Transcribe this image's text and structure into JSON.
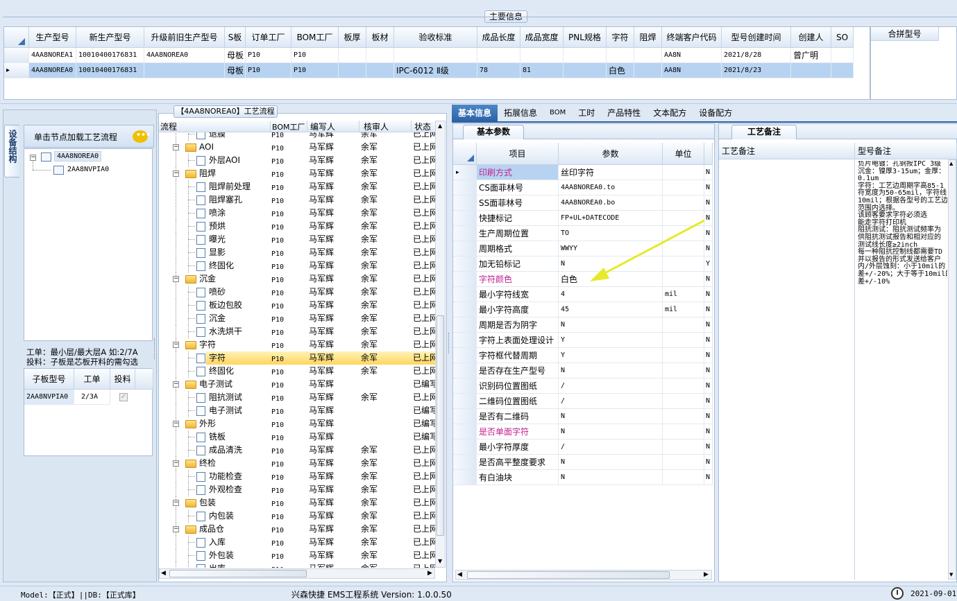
{
  "main": {
    "title": "主要信息",
    "columns": [
      "生产型号",
      "新生产型号",
      "升级前旧生产型号",
      "S板",
      "订单工厂",
      "BOM工厂",
      "板厚",
      "板材",
      "验收标准",
      "成品长度",
      "成品宽度",
      "PNL规格",
      "字符",
      "阻焊",
      "终端客户代码",
      "型号创建时间",
      "创建人",
      "SO"
    ],
    "rows": [
      [
        "4AA8NOREA1",
        "10010400176831",
        "4AA8NOREA0",
        "母板",
        "P10",
        "P10",
        "",
        "",
        "",
        "",
        "",
        "",
        "",
        "",
        "AA8N",
        "2021/8/28",
        "曾广明",
        ""
      ],
      [
        "4AA8NOREA0",
        "10010400176831",
        "",
        "母板",
        "P10",
        "P10",
        "",
        "",
        "IPC-6012 Ⅱ级",
        "78",
        "81",
        "",
        "白色",
        "",
        "AA8N",
        "2021/8/23",
        "",
        ""
      ]
    ],
    "merge_header": "合拼型号"
  },
  "left": {
    "side_tab": "设备结构",
    "load_hint": "单击节点加载工艺流程",
    "tree": [
      "4AA8NOREA0",
      "2AA8NVPIA0"
    ],
    "info1": "工单：最小层/最大层A 如:2/7A",
    "info2": "投料：子板是芯板开料的需勾选",
    "sub_headers": [
      "子板型号",
      "工单",
      "投料"
    ],
    "sub_row": [
      "2AA8NVPIA0",
      "2/3A"
    ]
  },
  "flow": {
    "title": "【4AA8NOREA0】工艺流程",
    "headers": [
      "流程",
      "BOM工厂",
      "编写人",
      "核审人",
      "状态"
    ],
    "rows": [
      {
        "indent": 2,
        "folder": false,
        "name": "退膜",
        "bom": "P10",
        "writer": "马军辉",
        "reviewer": "余军",
        "status": "已上网"
      },
      {
        "indent": 1,
        "folder": true,
        "name": "AOI",
        "bom": "P10",
        "writer": "马军辉",
        "reviewer": "余军",
        "status": "已上网"
      },
      {
        "indent": 2,
        "folder": false,
        "name": "外层AOI",
        "bom": "P10",
        "writer": "马军辉",
        "reviewer": "余军",
        "status": "已上网"
      },
      {
        "indent": 1,
        "folder": true,
        "name": "阻焊",
        "bom": "P10",
        "writer": "马军辉",
        "reviewer": "余军",
        "status": "已上网"
      },
      {
        "indent": 2,
        "folder": false,
        "name": "阻焊前处理",
        "bom": "P10",
        "writer": "马军辉",
        "reviewer": "余军",
        "status": "已上网"
      },
      {
        "indent": 2,
        "folder": false,
        "name": "阻焊塞孔",
        "bom": "P10",
        "writer": "马军辉",
        "reviewer": "余军",
        "status": "已上网"
      },
      {
        "indent": 2,
        "folder": false,
        "name": "喷涂",
        "bom": "P10",
        "writer": "马军辉",
        "reviewer": "余军",
        "status": "已上网"
      },
      {
        "indent": 2,
        "folder": false,
        "name": "预烘",
        "bom": "P10",
        "writer": "马军辉",
        "reviewer": "余军",
        "status": "已上网"
      },
      {
        "indent": 2,
        "folder": false,
        "name": "曝光",
        "bom": "P10",
        "writer": "马军辉",
        "reviewer": "余军",
        "status": "已上网"
      },
      {
        "indent": 2,
        "folder": false,
        "name": "显影",
        "bom": "P10",
        "writer": "马军辉",
        "reviewer": "余军",
        "status": "已上网"
      },
      {
        "indent": 2,
        "folder": false,
        "name": "终固化",
        "bom": "P10",
        "writer": "马军辉",
        "reviewer": "余军",
        "status": "已上网"
      },
      {
        "indent": 1,
        "folder": true,
        "name": "沉金",
        "bom": "P10",
        "writer": "马军辉",
        "reviewer": "余军",
        "status": "已上网"
      },
      {
        "indent": 2,
        "folder": false,
        "name": "喷砂",
        "bom": "P10",
        "writer": "马军辉",
        "reviewer": "余军",
        "status": "已上网"
      },
      {
        "indent": 2,
        "folder": false,
        "name": "板边包胶",
        "bom": "P10",
        "writer": "马军辉",
        "reviewer": "余军",
        "status": "已上网"
      },
      {
        "indent": 2,
        "folder": false,
        "name": "沉金",
        "bom": "P10",
        "writer": "马军辉",
        "reviewer": "余军",
        "status": "已上网"
      },
      {
        "indent": 2,
        "folder": false,
        "name": "水洗烘干",
        "bom": "P10",
        "writer": "马军辉",
        "reviewer": "余军",
        "status": "已上网"
      },
      {
        "indent": 1,
        "folder": true,
        "name": "字符",
        "bom": "P10",
        "writer": "马军辉",
        "reviewer": "余军",
        "status": "已上网"
      },
      {
        "indent": 2,
        "folder": false,
        "name": "字符",
        "bom": "P10",
        "writer": "马军辉",
        "reviewer": "余军",
        "status": "已上网",
        "selected": true
      },
      {
        "indent": 2,
        "folder": false,
        "name": "终固化",
        "bom": "P10",
        "writer": "马军辉",
        "reviewer": "余军",
        "status": "已上网"
      },
      {
        "indent": 1,
        "folder": true,
        "name": "电子测试",
        "bom": "P10",
        "writer": "马军辉",
        "reviewer": "",
        "status": "已编写"
      },
      {
        "indent": 2,
        "folder": false,
        "name": "阻抗测试",
        "bom": "P10",
        "writer": "马军辉",
        "reviewer": "余军",
        "status": "已上网"
      },
      {
        "indent": 2,
        "folder": false,
        "name": "电子测试",
        "bom": "P10",
        "writer": "马军辉",
        "reviewer": "",
        "status": "已编写"
      },
      {
        "indent": 1,
        "folder": true,
        "name": "外形",
        "bom": "P10",
        "writer": "马军辉",
        "reviewer": "",
        "status": "已编写"
      },
      {
        "indent": 2,
        "folder": false,
        "name": "铣板",
        "bom": "P10",
        "writer": "马军辉",
        "reviewer": "",
        "status": "已编写"
      },
      {
        "indent": 2,
        "folder": false,
        "name": "成品清洗",
        "bom": "P10",
        "writer": "马军辉",
        "reviewer": "余军",
        "status": "已上网"
      },
      {
        "indent": 1,
        "folder": true,
        "name": "终检",
        "bom": "P10",
        "writer": "马军辉",
        "reviewer": "余军",
        "status": "已上网"
      },
      {
        "indent": 2,
        "folder": false,
        "name": "功能检查",
        "bom": "P10",
        "writer": "马军辉",
        "reviewer": "余军",
        "status": "已上网"
      },
      {
        "indent": 2,
        "folder": false,
        "name": "外观检查",
        "bom": "P10",
        "writer": "马军辉",
        "reviewer": "余军",
        "status": "已上网"
      },
      {
        "indent": 1,
        "folder": true,
        "name": "包装",
        "bom": "P10",
        "writer": "马军辉",
        "reviewer": "余军",
        "status": "已上网"
      },
      {
        "indent": 2,
        "folder": false,
        "name": "内包装",
        "bom": "P10",
        "writer": "马军辉",
        "reviewer": "余军",
        "status": "已上网"
      },
      {
        "indent": 1,
        "folder": true,
        "name": "成品仓",
        "bom": "P10",
        "writer": "马军辉",
        "reviewer": "余军",
        "status": "已上网"
      },
      {
        "indent": 2,
        "folder": false,
        "name": "入库",
        "bom": "P10",
        "writer": "马军辉",
        "reviewer": "余军",
        "status": "已上网"
      },
      {
        "indent": 2,
        "folder": false,
        "name": "外包装",
        "bom": "P10",
        "writer": "马军辉",
        "reviewer": "余军",
        "status": "已上网"
      },
      {
        "indent": 2,
        "folder": false,
        "name": "出库",
        "bom": "P10",
        "writer": "马军辉",
        "reviewer": "余军",
        "status": "已上网"
      }
    ]
  },
  "tabs": [
    "基本信息",
    "拓展信息",
    "BOM",
    "工时",
    "产品特性",
    "文本配方",
    "设备配方"
  ],
  "params": {
    "title": "基本参数",
    "headers": [
      "项目",
      "参数",
      "单位"
    ],
    "rows": [
      {
        "item": "印刷方式",
        "value": "丝印字符",
        "unit": "",
        "flag": "N",
        "pink": true,
        "current": true
      },
      {
        "item": "CS面菲林号",
        "value": "4AA8NOREA0.to",
        "unit": "",
        "flag": "N"
      },
      {
        "item": "SS面菲林号",
        "value": "4AA8NOREA0.bo",
        "unit": "",
        "flag": "N"
      },
      {
        "item": "快捷标记",
        "value": "FP+UL+DATECODE",
        "unit": "",
        "flag": "N"
      },
      {
        "item": "生产周期位置",
        "value": "TO",
        "unit": "",
        "flag": "N"
      },
      {
        "item": "周期格式",
        "value": "WWYY",
        "unit": "",
        "flag": "N"
      },
      {
        "item": "加无铅标记",
        "value": "N",
        "unit": "",
        "flag": "Y"
      },
      {
        "item": "字符颜色",
        "value": "白色",
        "unit": "",
        "flag": "N",
        "pink": true
      },
      {
        "item": "最小字符线宽",
        "value": "4",
        "unit": "mil",
        "flag": "N"
      },
      {
        "item": "最小字符高度",
        "value": "45",
        "unit": "mil",
        "flag": "N"
      },
      {
        "item": "周期是否为阴字",
        "value": "N",
        "unit": "",
        "flag": "N"
      },
      {
        "item": "字符上表面处理设计",
        "value": "Y",
        "unit": "",
        "flag": "N"
      },
      {
        "item": "字符框代替周期",
        "value": "Y",
        "unit": "",
        "flag": "N"
      },
      {
        "item": "是否存在生产型号",
        "value": "N",
        "unit": "",
        "flag": "N"
      },
      {
        "item": "识别码位置图纸",
        "value": "/",
        "unit": "",
        "flag": "N"
      },
      {
        "item": "二维码位置图纸",
        "value": "/",
        "unit": "",
        "flag": "N"
      },
      {
        "item": "是否有二维码",
        "value": "N",
        "unit": "",
        "flag": "N"
      },
      {
        "item": "是否单面字符",
        "value": "N",
        "unit": "",
        "flag": "N",
        "pink": true
      },
      {
        "item": "最小字符厚度",
        "value": "/",
        "unit": "",
        "flag": "N"
      },
      {
        "item": "是否高平整度要求",
        "value": "N",
        "unit": "",
        "flag": "N"
      },
      {
        "item": "有白油块",
        "value": "N",
        "unit": "",
        "flag": "N"
      }
    ]
  },
  "notes": {
    "title": "工艺备注",
    "col1": "工艺备注",
    "col2": "型号备注",
    "lines": [
      "负片电镀：孔铜按IPC 3级",
      "沉金：镍厚3-15um；金厚：",
      "0.1um",
      "字符：工艺边周期字高85-1",
      "符宽度为50-65mil，字符线",
      "10mil；根据各型号的工艺边",
      "范围内选择。",
      "      该顾客要求字符必须选",
      "能走字符打印机",
      "阻抗测试：阻抗测试频率为",
      "供阻抗测试报告和相对应的",
      "测试线长度≥2inch",
      "每一种阻抗控制线都需要TD",
      "并以报告的形式发送给客户",
      "内/外层蚀刻：小于10mil的",
      "差+/-20%；大于等于10mil的",
      "差+/-10%"
    ]
  },
  "status": {
    "left": "Model:【正式】||DB:【正式库】",
    "center": "兴森快捷 EMS工程系统 Version: 1.0.0.50",
    "date": "2021-09-01"
  },
  "colors": {
    "accent": "#2b62a6",
    "pink": "#c0208f",
    "selected_row": "#b7d3f1",
    "arrow": "#e6ea2a"
  }
}
